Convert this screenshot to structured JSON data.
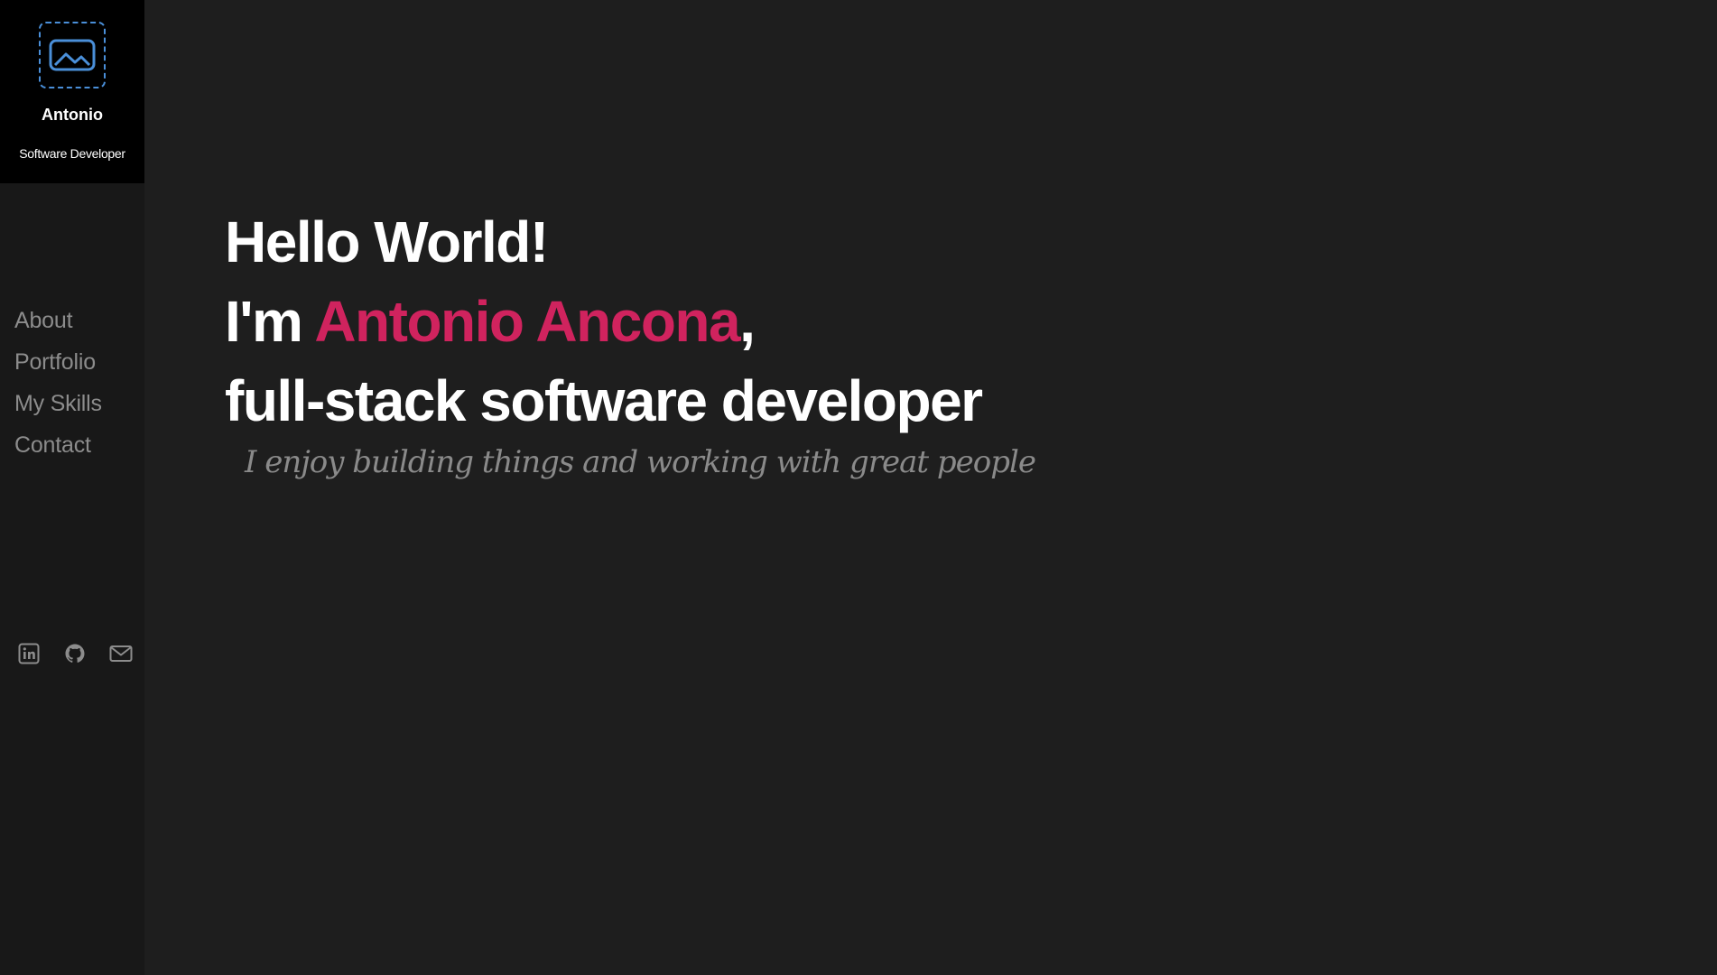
{
  "profile": {
    "name": "Antonio",
    "role": "Software Developer",
    "avatar_icon": "image-placeholder-icon"
  },
  "nav": {
    "items": [
      {
        "label": "About"
      },
      {
        "label": "Portfolio"
      },
      {
        "label": "My Skills"
      },
      {
        "label": "Contact"
      }
    ]
  },
  "social": [
    {
      "icon": "linkedin-icon"
    },
    {
      "icon": "github-icon"
    },
    {
      "icon": "mail-icon"
    }
  ],
  "hero": {
    "line1": "Hello World!",
    "line2_prefix": "I'm ",
    "line2_name": "Antonio Ancona",
    "line2_suffix": ",",
    "line3": "full-stack software developer",
    "tagline": "I enjoy building things and working with great people"
  },
  "colors": {
    "accent": "#d0235e",
    "background": "#1e1e1e",
    "sidebar": "#181818",
    "profile_bg": "#000000",
    "icon_blue": "#4a8fd9",
    "muted_text": "#8c8c8c"
  }
}
